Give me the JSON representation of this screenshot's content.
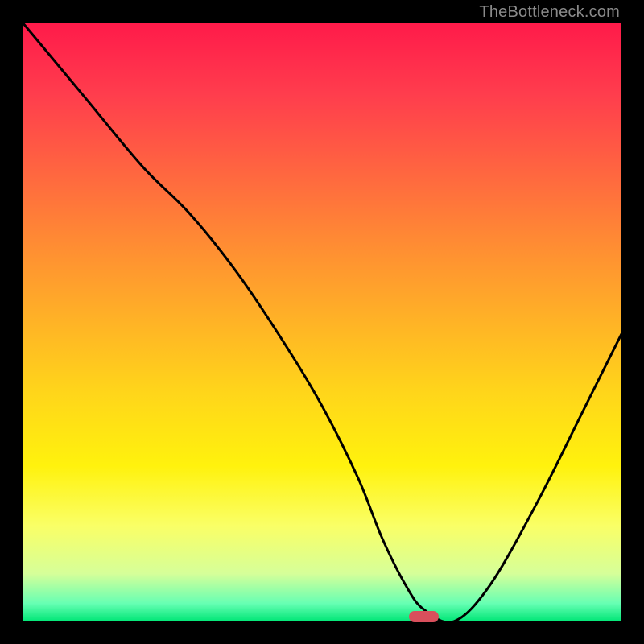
{
  "watermark": "TheBottleneck.com",
  "colors": {
    "background": "#000000",
    "curve": "#000000",
    "marker": "#d94f5c"
  },
  "chart_data": {
    "type": "line",
    "title": "",
    "xlabel": "",
    "ylabel": "",
    "xlim": [
      0,
      100
    ],
    "ylim": [
      0,
      100
    ],
    "grid": false,
    "legend": false,
    "series": [
      {
        "name": "bottleneck-curve",
        "x": [
          0,
          10,
          20,
          28,
          36,
          44,
          50,
          56,
          60,
          64,
          67,
          72,
          78,
          86,
          94,
          100
        ],
        "values": [
          100,
          88,
          76,
          68,
          58,
          46,
          36,
          24,
          14,
          6,
          2,
          0,
          6,
          20,
          36,
          48
        ]
      }
    ],
    "marker": {
      "x_center": 67,
      "y": 0,
      "width_pct": 5
    },
    "gradient_stops": [
      {
        "pos": 0,
        "color": "#ff1a4a"
      },
      {
        "pos": 25,
        "color": "#ff6640"
      },
      {
        "pos": 50,
        "color": "#ffb326"
      },
      {
        "pos": 74,
        "color": "#fff20d"
      },
      {
        "pos": 92,
        "color": "#d6ff99"
      },
      {
        "pos": 100,
        "color": "#00e676"
      }
    ]
  }
}
